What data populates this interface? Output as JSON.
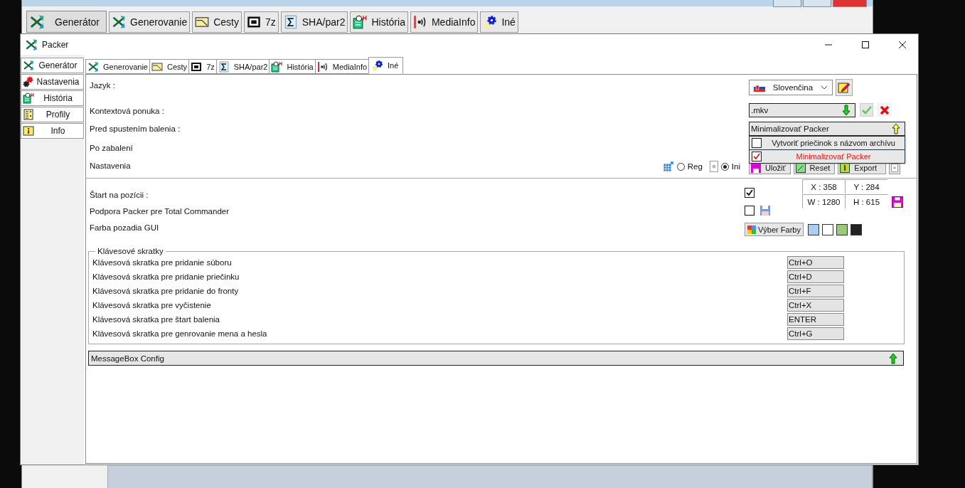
{
  "back_window": {
    "side_button": {
      "label": "Generátor"
    },
    "tabs": [
      {
        "label": "Generovanie"
      },
      {
        "label": "Cesty"
      },
      {
        "label": "7z"
      },
      {
        "label": "SHA/par2"
      },
      {
        "label": "História"
      },
      {
        "label": "MediaInfo"
      },
      {
        "label": "Iné"
      }
    ]
  },
  "window": {
    "title": "Packer"
  },
  "sidebar": {
    "items": [
      {
        "label": "Generátor"
      },
      {
        "label": "Nastavenia"
      },
      {
        "label": "História"
      },
      {
        "label": "Profily"
      },
      {
        "label": "Info"
      }
    ]
  },
  "tabs": [
    {
      "label": "Generovanie",
      "selected": false
    },
    {
      "label": "Cesty",
      "selected": false
    },
    {
      "label": "7z",
      "selected": false
    },
    {
      "label": "SHA/par2",
      "selected": false
    },
    {
      "label": "História",
      "selected": false
    },
    {
      "label": "MediaInfo",
      "selected": false
    },
    {
      "label": "Iné",
      "selected": true
    }
  ],
  "language": {
    "label": "Jazyk :",
    "value": "Slovenčina"
  },
  "context_menu": {
    "label": "Kontextová ponuka :",
    "value": ".mkv"
  },
  "before_packing": {
    "label": "Pred spustením balenia :",
    "value": "Minimalizovať Packer",
    "expanded": true,
    "options": [
      {
        "label": "Vytvoriť priečinok s názvom archívu",
        "checked": false
      },
      {
        "label": "Minimalizovať Packer",
        "checked": true
      }
    ]
  },
  "after_packing": {
    "label": "Po zabalení"
  },
  "settings": {
    "label": "Nastavenia",
    "storage": [
      {
        "label": "Reg",
        "selected": false
      },
      {
        "label": "Ini",
        "selected": true
      }
    ],
    "buttons": [
      "Uložiť",
      "Reset",
      "Export"
    ]
  },
  "start_position": {
    "label": "Štart na pozícii :",
    "checked": true,
    "coords": [
      "X : 358",
      "Y : 284",
      "W : 1280",
      "H : 615"
    ]
  },
  "tc_support": {
    "label": "Podpora Packer pre Total Commander",
    "checked": false
  },
  "background_color": {
    "label": "Farba pozadia GUI",
    "button": "Výber Farby",
    "swatches": [
      {
        "color": "#abcdef"
      },
      {
        "color": "#ffffff"
      },
      {
        "color": "#99cc77"
      },
      {
        "color": "#222222"
      }
    ]
  },
  "shortcuts": {
    "title": "Klávesové skratky",
    "rows": [
      {
        "label": "Klávesová skratka pre pridanie súboru",
        "value": "Ctrl+O"
      },
      {
        "label": "Klávesová skratka pre pridanie priečinku",
        "value": "Ctrl+D"
      },
      {
        "label": "Klávesová skratka pre pridanie do fronty",
        "value": "Ctrl+F"
      },
      {
        "label": "Klávesová skratka pre vyčistenie",
        "value": "Ctrl+X"
      },
      {
        "label": "Klávesová skratka pre štart balenia",
        "value": "ENTER"
      },
      {
        "label": "Klávesová skratka pre genrovanie mena a hesla",
        "value": "Ctrl+G"
      }
    ]
  },
  "messagebox": {
    "label": "MessageBox Config"
  }
}
